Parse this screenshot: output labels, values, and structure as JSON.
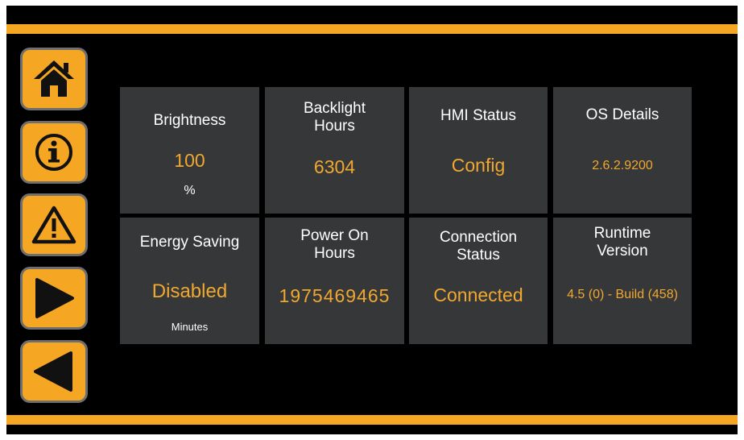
{
  "nav": {
    "buttons": [
      {
        "name": "home",
        "icon": "home-icon"
      },
      {
        "name": "info",
        "icon": "info-icon"
      },
      {
        "name": "alarm",
        "icon": "warning-icon"
      },
      {
        "name": "next",
        "icon": "play-right-icon"
      },
      {
        "name": "back",
        "icon": "play-left-icon"
      }
    ]
  },
  "colors": {
    "accent": "#f5a623",
    "tile_bg": "#363738",
    "value_text": "#f0a830",
    "screen_bg": "#000000"
  },
  "tiles": {
    "brightness": {
      "label": "Brightness",
      "value": "100",
      "unit": "%"
    },
    "backlight_hours": {
      "label_line1": "Backlight",
      "label_line2": "Hours",
      "value": "6304"
    },
    "hmi_status": {
      "label": "HMI Status",
      "value": "Config"
    },
    "os_details": {
      "label": "OS Details",
      "value": "2.6.2.9200"
    },
    "energy_saving": {
      "label": "Energy Saving",
      "value": "Disabled",
      "unit": "Minutes"
    },
    "power_on_hours": {
      "label_line1": "Power On",
      "label_line2": "Hours",
      "value": "1975469465"
    },
    "connection_status": {
      "label_line1": "Connection",
      "label_line2": "Status",
      "value": "Connected"
    },
    "runtime_version": {
      "label_line1": "Runtime",
      "label_line2": "Version",
      "value": "4.5 (0) - Build (458)"
    }
  }
}
